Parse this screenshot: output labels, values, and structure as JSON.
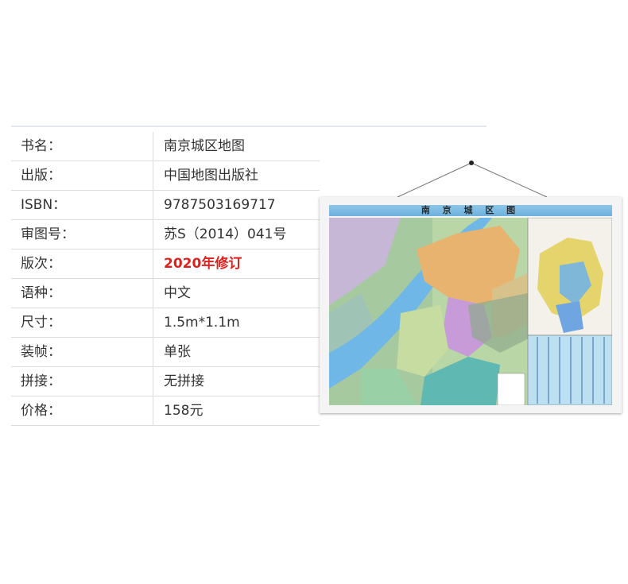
{
  "spec": {
    "rows": [
      {
        "label": "书名：",
        "value": "南京城区地图"
      },
      {
        "label": "出版：",
        "value": "中国地图出版社"
      },
      {
        "label": "ISBN：",
        "value": "9787503169717"
      },
      {
        "label": "审图号：",
        "value": "苏S（2014）041号"
      },
      {
        "label": "版次：",
        "value": "2020年修订"
      },
      {
        "label": "语种：",
        "value": "中文"
      },
      {
        "label": "尺寸：",
        "value": "1.5m*1.1m"
      },
      {
        "label": "装帧：",
        "value": "单张"
      },
      {
        "label": "拼接：",
        "value": "无拼接"
      },
      {
        "label": "价格：",
        "value": "158元"
      }
    ]
  },
  "poster": {
    "title": "南 京 城 区 图"
  },
  "colors": {
    "highlight": "#e0201c",
    "header_bar": "#8ec6e8"
  }
}
